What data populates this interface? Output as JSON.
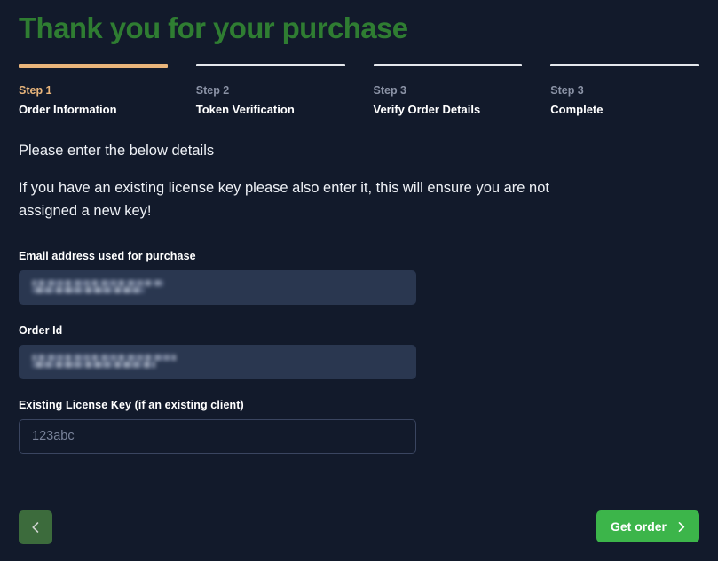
{
  "page": {
    "title": "Thank you for your purchase",
    "title_color": "#2f7d32",
    "background_color": "#121a2b"
  },
  "stepper": {
    "active_color": "#e9b57b",
    "inactive_color": "#e4e7ec",
    "steps": [
      {
        "number": "Step 1",
        "label": "Order Information",
        "active": true
      },
      {
        "number": "Step 2",
        "label": "Token Verification",
        "active": false
      },
      {
        "number": "Step 3",
        "label": "Verify Order Details",
        "active": false
      },
      {
        "number": "Step 3",
        "label": "Complete",
        "active": false
      }
    ]
  },
  "intro": {
    "lead": "Please enter the below details",
    "note": "If you have an existing license key please also enter it, this will ensure you are not assigned a new key!"
  },
  "form": {
    "email": {
      "label": "Email address used for purchase",
      "value": "███████████████",
      "redacted": true,
      "placeholder": ""
    },
    "order_id": {
      "label": "Order Id",
      "value": "████████████████",
      "redacted": true,
      "placeholder": ""
    },
    "license_key": {
      "label": "Existing License Key (if an existing client)",
      "value": "",
      "redacted": false,
      "placeholder": "123abc"
    }
  },
  "actions": {
    "back": {
      "label": "",
      "icon": "chevron-left-icon",
      "color": "#3c6b3c"
    },
    "next": {
      "label": "Get order",
      "icon": "chevron-right-icon",
      "color": "#3cb54a"
    }
  }
}
